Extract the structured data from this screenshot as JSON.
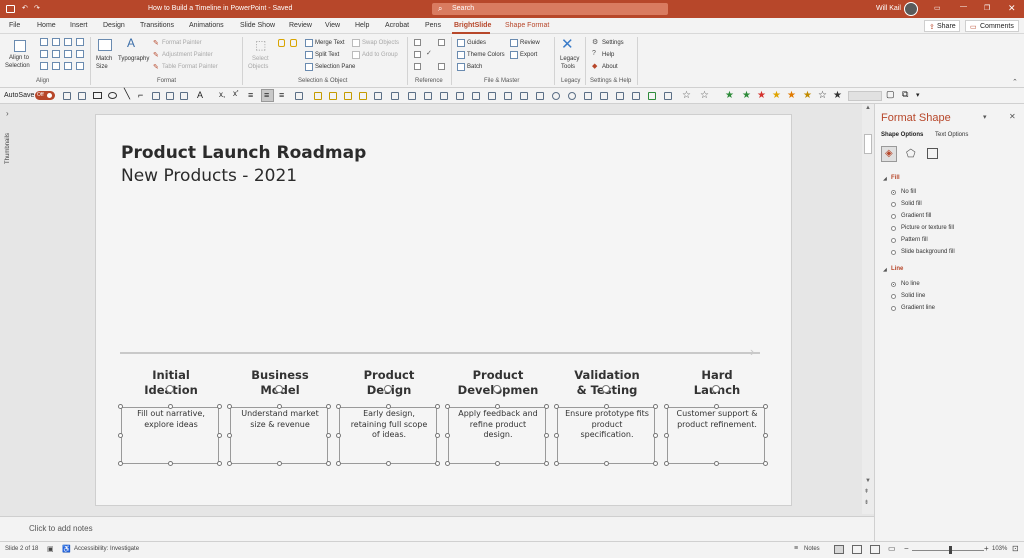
{
  "app": {
    "doc_title": "How to Build a Timeline in PowerPoint  -  Saved",
    "search_placeholder": "Search",
    "user": "Will Kail",
    "share": "Share",
    "comments": "Comments"
  },
  "tabs": [
    "File",
    "Home",
    "Insert",
    "Design",
    "Transitions",
    "Animations",
    "Slide Show",
    "Review",
    "View",
    "Help",
    "Acrobat",
    "Pens",
    "BrightSlide",
    "Shape Format"
  ],
  "ribbon": {
    "align_to_selection": "Align to",
    "align_to_selection2": "Selection",
    "group_align": "Align",
    "match_size": "Match",
    "match_size2": "Size",
    "typography": "Typography",
    "format_painter": "Format Painter",
    "adjustment_painter": "Adjustment Painter",
    "table_format_painter": "Table Format Painter",
    "group_format": "Format",
    "select_objects": "Select",
    "select_objects2": "Objects",
    "merge_text": "Merge Text",
    "split_text": "Split Text",
    "selection_pane": "Selection Pane",
    "swap_objects": "Swap Objects",
    "add_to_group": "Add to Group",
    "group_selection": "Selection & Object",
    "group_reference": "Reference",
    "guides": "Guides",
    "theme_colors": "Theme Colors",
    "batch": "Batch",
    "review": "Review",
    "export": "Export",
    "group_file_master": "File & Master",
    "legacy_tools": "Legacy",
    "legacy_tools2": "Tools",
    "group_legacy": "Legacy",
    "settings": "Settings",
    "help": "Help",
    "about": "About",
    "group_settings": "Settings & Help"
  },
  "qat": {
    "autosave": "AutoSave",
    "autosave_state": "Off"
  },
  "slide": {
    "title": "Product Launch Roadmap",
    "subtitle": "New Products - 2021",
    "steps": [
      {
        "heading1": "Initial",
        "heading2": "Ideation",
        "desc": [
          "Fill out narrative,",
          "explore ideas"
        ]
      },
      {
        "heading1": "Business",
        "heading2": "Model",
        "desc": [
          "Understand market",
          "size & revenue"
        ]
      },
      {
        "heading1": "Product",
        "heading2": "Design",
        "desc": [
          "Early design,",
          "retaining full scope",
          "of ideas."
        ]
      },
      {
        "heading1": "Product",
        "heading2": "Developmen",
        "desc": [
          "Apply feedback and",
          "refine product",
          "design."
        ]
      },
      {
        "heading1": "Validation",
        "heading2": "& Testing",
        "desc": [
          "Ensure prototype fits",
          "product",
          "specification."
        ]
      },
      {
        "heading1": "Hard",
        "heading2": "Launch",
        "desc": [
          "Customer support &",
          "product refinement."
        ]
      }
    ]
  },
  "thumbnails_label": "Thumbnails",
  "notes_placeholder": "Click to add notes",
  "format_pane": {
    "title": "Format Shape",
    "tab_shape": "Shape Options",
    "tab_text": "Text Options",
    "fill_title": "Fill",
    "fill_options": [
      "No fill",
      "Solid fill",
      "Gradient fill",
      "Picture or texture fill",
      "Pattern fill",
      "Slide background fill"
    ],
    "fill_selected": 0,
    "line_title": "Line",
    "line_options": [
      "No line",
      "Solid line",
      "Gradient line"
    ],
    "line_selected": 0
  },
  "status": {
    "slide_info": "Slide 2 of 18",
    "accessibility": "Accessibility: Investigate",
    "notes": "Notes",
    "zoom": "103%"
  },
  "colors": {
    "accent": "#b7472a",
    "ribbon_bg": "#f3f3f3",
    "workspace_bg": "#e6e6e6"
  }
}
